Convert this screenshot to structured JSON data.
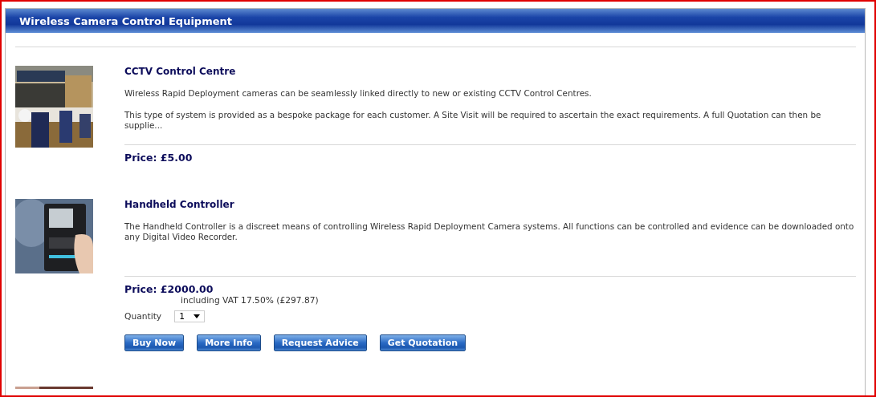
{
  "panel": {
    "title": "Wireless Camera Control Equipment"
  },
  "products": [
    {
      "name": "CCTV Control Centre",
      "paragraphs": [
        "Wireless Rapid Deployment cameras can be seamlessly linked directly to new or existing CCTV Control Centres.",
        "This type of system is provided as a bespoke package for each customer. A Site Visit will be required to ascertain the exact requirements. A full Quotation can then be supplie..."
      ],
      "price": "Price: £5.00"
    },
    {
      "name": "Handheld Controller",
      "paragraphs": [
        "The Handheld Controller is a discreet means of controlling Wireless Rapid Deployment Camera systems. All functions can be controlled and evidence can be downloaded onto any Digital Video Recorder."
      ],
      "price": "Price: £2000.00",
      "vat": "including VAT 17.50% (£297.87)",
      "quantity_label": "Quantity",
      "quantity": "1",
      "buttons": [
        "Buy Now",
        "More Info",
        "Request Advice",
        "Get Quotation"
      ]
    },
    {
      "kind": "picture"
    }
  ]
}
